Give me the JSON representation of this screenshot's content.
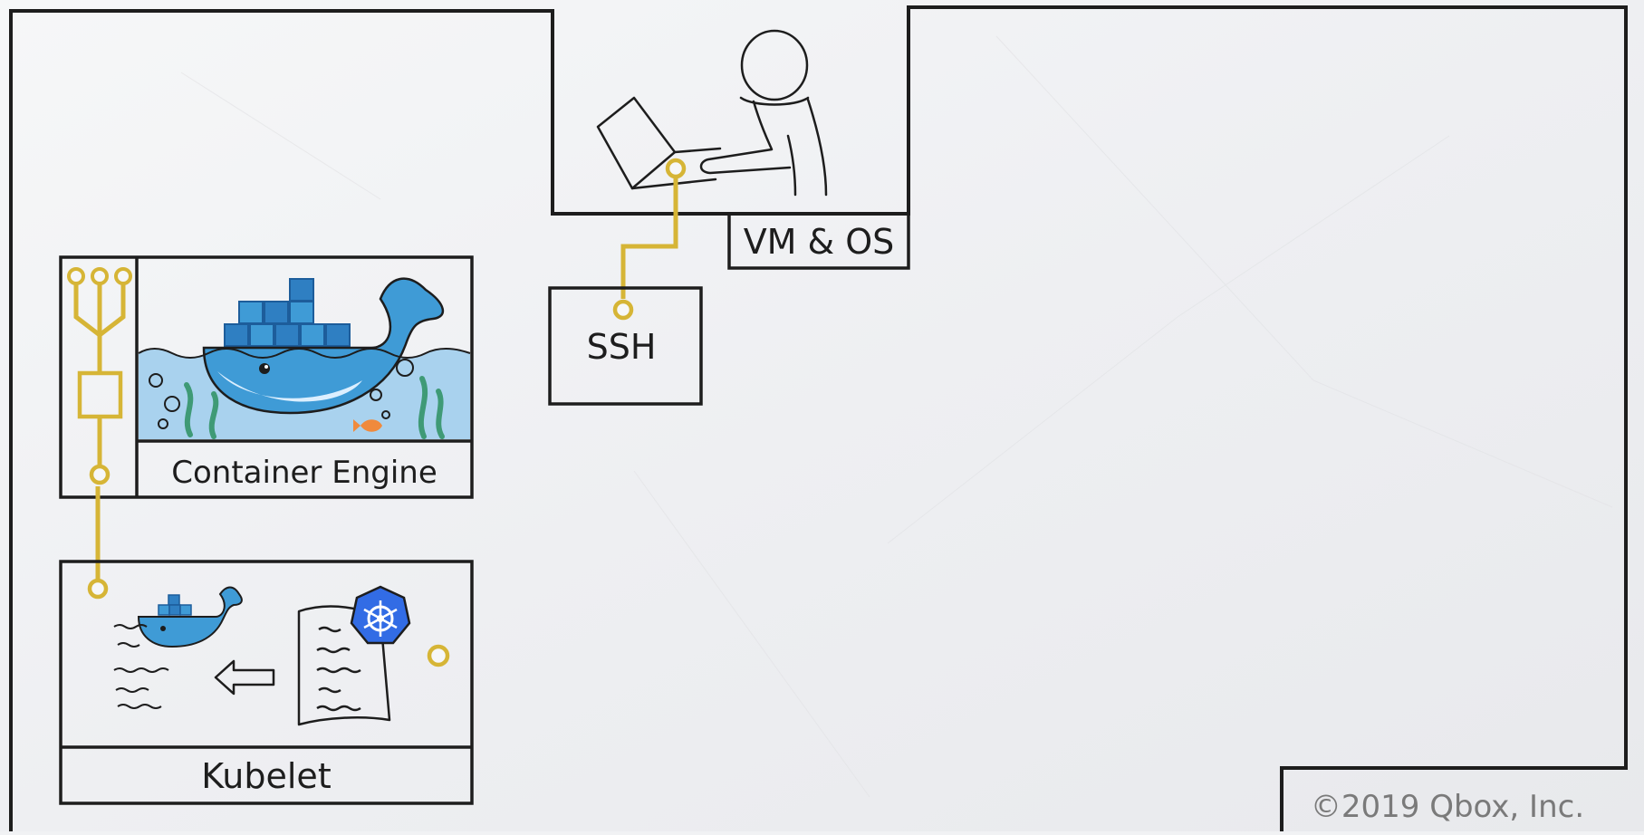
{
  "labels": {
    "vm_os": "VM & OS",
    "ssh": "SSH",
    "container_engine": "Container Engine",
    "kubelet": "Kubelet",
    "copyright": "©2019 Qbox, Inc."
  },
  "colors": {
    "paper": "#f1f2f4",
    "ink": "#1d1d1d",
    "connector": "#d6b536",
    "docker_blue": "#3f9bd6",
    "docker_dark": "#1d5d9b",
    "water": "#a9d2ee",
    "seaweed": "#3f9a76",
    "k8s_blue": "#326ce5"
  },
  "icons": {
    "person": "person-at-laptop-icon",
    "docker": "docker-whale-icon",
    "kubernetes": "kubernetes-helm-icon",
    "arrow": "arrow-left-icon"
  }
}
